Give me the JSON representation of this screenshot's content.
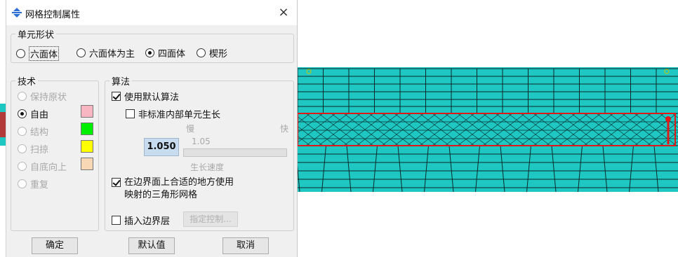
{
  "dialog": {
    "title": "网格控制属性",
    "close": "×"
  },
  "element_shape": {
    "group_title": "单元形状",
    "options": [
      {
        "label": "六面体",
        "checked": false
      },
      {
        "label": "六面体为主",
        "checked": false
      },
      {
        "label": "四面体",
        "checked": true
      },
      {
        "label": "楔形",
        "checked": false
      }
    ]
  },
  "technique": {
    "group_title": "技术",
    "options": [
      {
        "label": "保持原状",
        "checked": false,
        "enabled": false,
        "color": ""
      },
      {
        "label": "自由",
        "checked": true,
        "enabled": true,
        "color": "#f7b6c2"
      },
      {
        "label": "结构",
        "checked": false,
        "enabled": false,
        "color": "#00ee00"
      },
      {
        "label": "扫掠",
        "checked": false,
        "enabled": false,
        "color": "#ffff00"
      },
      {
        "label": "自底向上",
        "checked": false,
        "enabled": false,
        "color": "#f8d8b4"
      },
      {
        "label": "重复",
        "checked": false,
        "enabled": false,
        "color": ""
      }
    ]
  },
  "algorithm": {
    "group_title": "算法",
    "use_default": {
      "label": "使用默认算法",
      "checked": true
    },
    "nonstandard_growth": {
      "label": "非标准内部单元生长",
      "checked": false
    },
    "slow_label": "慢",
    "fast_label": "快",
    "growth_value": "1.050",
    "growth_hint": "1.05",
    "growth_speed_label": "生长速度",
    "mapped_tri": {
      "line1": "在边界面上合适的地方使用",
      "line2": "映射的三角形网格",
      "checked": true
    },
    "insert_boundary": {
      "label": "插入边界层",
      "checked": false
    },
    "specify_controls_label": "指定控制..."
  },
  "buttons": {
    "ok": "确定",
    "defaults": "默认值",
    "cancel": "取消"
  },
  "colors": {
    "mesh_fill": "#1ec7c2",
    "mesh_line": "#0c2a2a",
    "highlight": "#e01818",
    "vertex_marker": "#c8c800"
  }
}
